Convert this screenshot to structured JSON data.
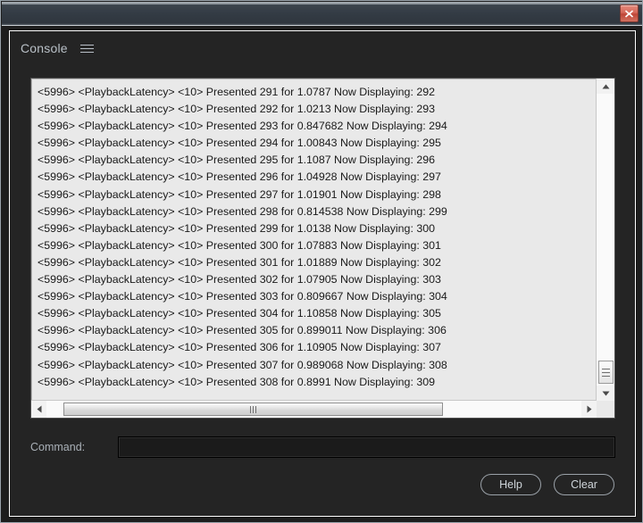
{
  "window": {
    "close_icon": "close-icon"
  },
  "header": {
    "title": "Console",
    "menu_icon": "hamburger-menu-icon"
  },
  "log": {
    "lines": [
      "<5996> <PlaybackLatency> <10> Presented 291 for 1.0787 Now Displaying: 292",
      "<5996> <PlaybackLatency> <10> Presented 292 for 1.0213 Now Displaying: 293",
      "<5996> <PlaybackLatency> <10> Presented 293 for 0.847682 Now Displaying: 294",
      "<5996> <PlaybackLatency> <10> Presented 294 for 1.00843 Now Displaying: 295",
      "<5996> <PlaybackLatency> <10> Presented 295 for 1.1087 Now Displaying: 296",
      "<5996> <PlaybackLatency> <10> Presented 296 for 1.04928 Now Displaying: 297",
      "<5996> <PlaybackLatency> <10> Presented 297 for 1.01901 Now Displaying: 298",
      "<5996> <PlaybackLatency> <10> Presented 298 for 0.814538 Now Displaying: 299",
      "<5996> <PlaybackLatency> <10> Presented 299 for 1.0138 Now Displaying: 300",
      "<5996> <PlaybackLatency> <10> Presented 300 for 1.07883 Now Displaying: 301",
      "<5996> <PlaybackLatency> <10> Presented 301 for 1.01889 Now Displaying: 302",
      "<5996> <PlaybackLatency> <10> Presented 302 for 1.07905 Now Displaying: 303",
      "<5996> <PlaybackLatency> <10> Presented 303 for 0.809667 Now Displaying: 304",
      "<5996> <PlaybackLatency> <10> Presented 304 for 1.10858 Now Displaying: 305",
      "<5996> <PlaybackLatency> <10> Presented 305 for 0.899011 Now Displaying: 306",
      "<5996> <PlaybackLatency> <10> Presented 306 for 1.10905 Now Displaying: 307",
      "<5996> <PlaybackLatency> <10> Presented 307 for 0.989068 Now Displaying: 308",
      "<5996> <PlaybackLatency> <10> Presented 308 for 0.8991 Now Displaying: 309"
    ]
  },
  "scrollbars": {
    "vertical": {
      "up_icon": "scroll-up-arrow-icon",
      "down_icon": "scroll-down-arrow-icon",
      "thumb_icon": "scroll-thumb-grip-icon"
    },
    "horizontal": {
      "left_icon": "scroll-left-arrow-icon",
      "right_icon": "scroll-right-arrow-icon",
      "thumb_icon": "scroll-thumb-grip-icon"
    }
  },
  "command": {
    "label": "Command:",
    "value": "",
    "placeholder": ""
  },
  "footer": {
    "help_label": "Help",
    "clear_label": "Clear"
  },
  "colors": {
    "titlebar_top": "#8e949c",
    "titlebar_bottom": "#2f363e",
    "close_button": "#d4685a",
    "app_background": "#242424",
    "log_background": "#e9e9e9",
    "accent_text": "#b9c0c7"
  }
}
